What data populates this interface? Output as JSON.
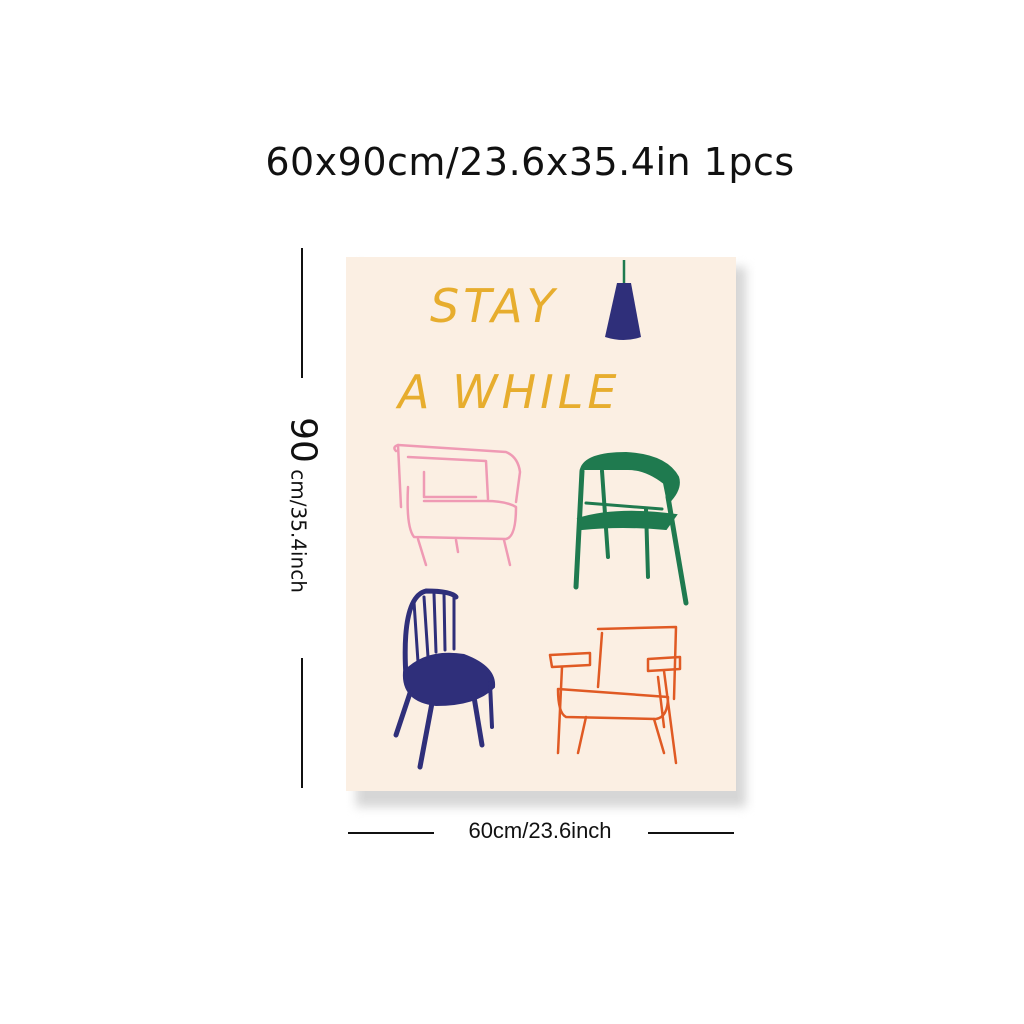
{
  "header": {
    "title": "60x90cm/23.6x35.4in 1pcs"
  },
  "dimensions": {
    "height_value": "90",
    "height_unit": " cm/35.4inch",
    "width_label": "60cm/23.6inch"
  },
  "poster": {
    "line1": "STAY",
    "line2": "A WHILE"
  },
  "colors": {
    "poster_background": "#fbefe3",
    "text_yellow": "#e7ad2e",
    "lamp_navy": "#2f2f7a",
    "armchair_pink": "#ef9ab4",
    "chair_green": "#1f7a4f",
    "spindle_chair_navy": "#2f2f7a",
    "armchair_orange": "#e05a24"
  },
  "icons": [
    "pendant-lamp-icon",
    "pink-armchair-icon",
    "green-chair-icon",
    "navy-spindle-chair-icon",
    "orange-armchair-icon"
  ]
}
